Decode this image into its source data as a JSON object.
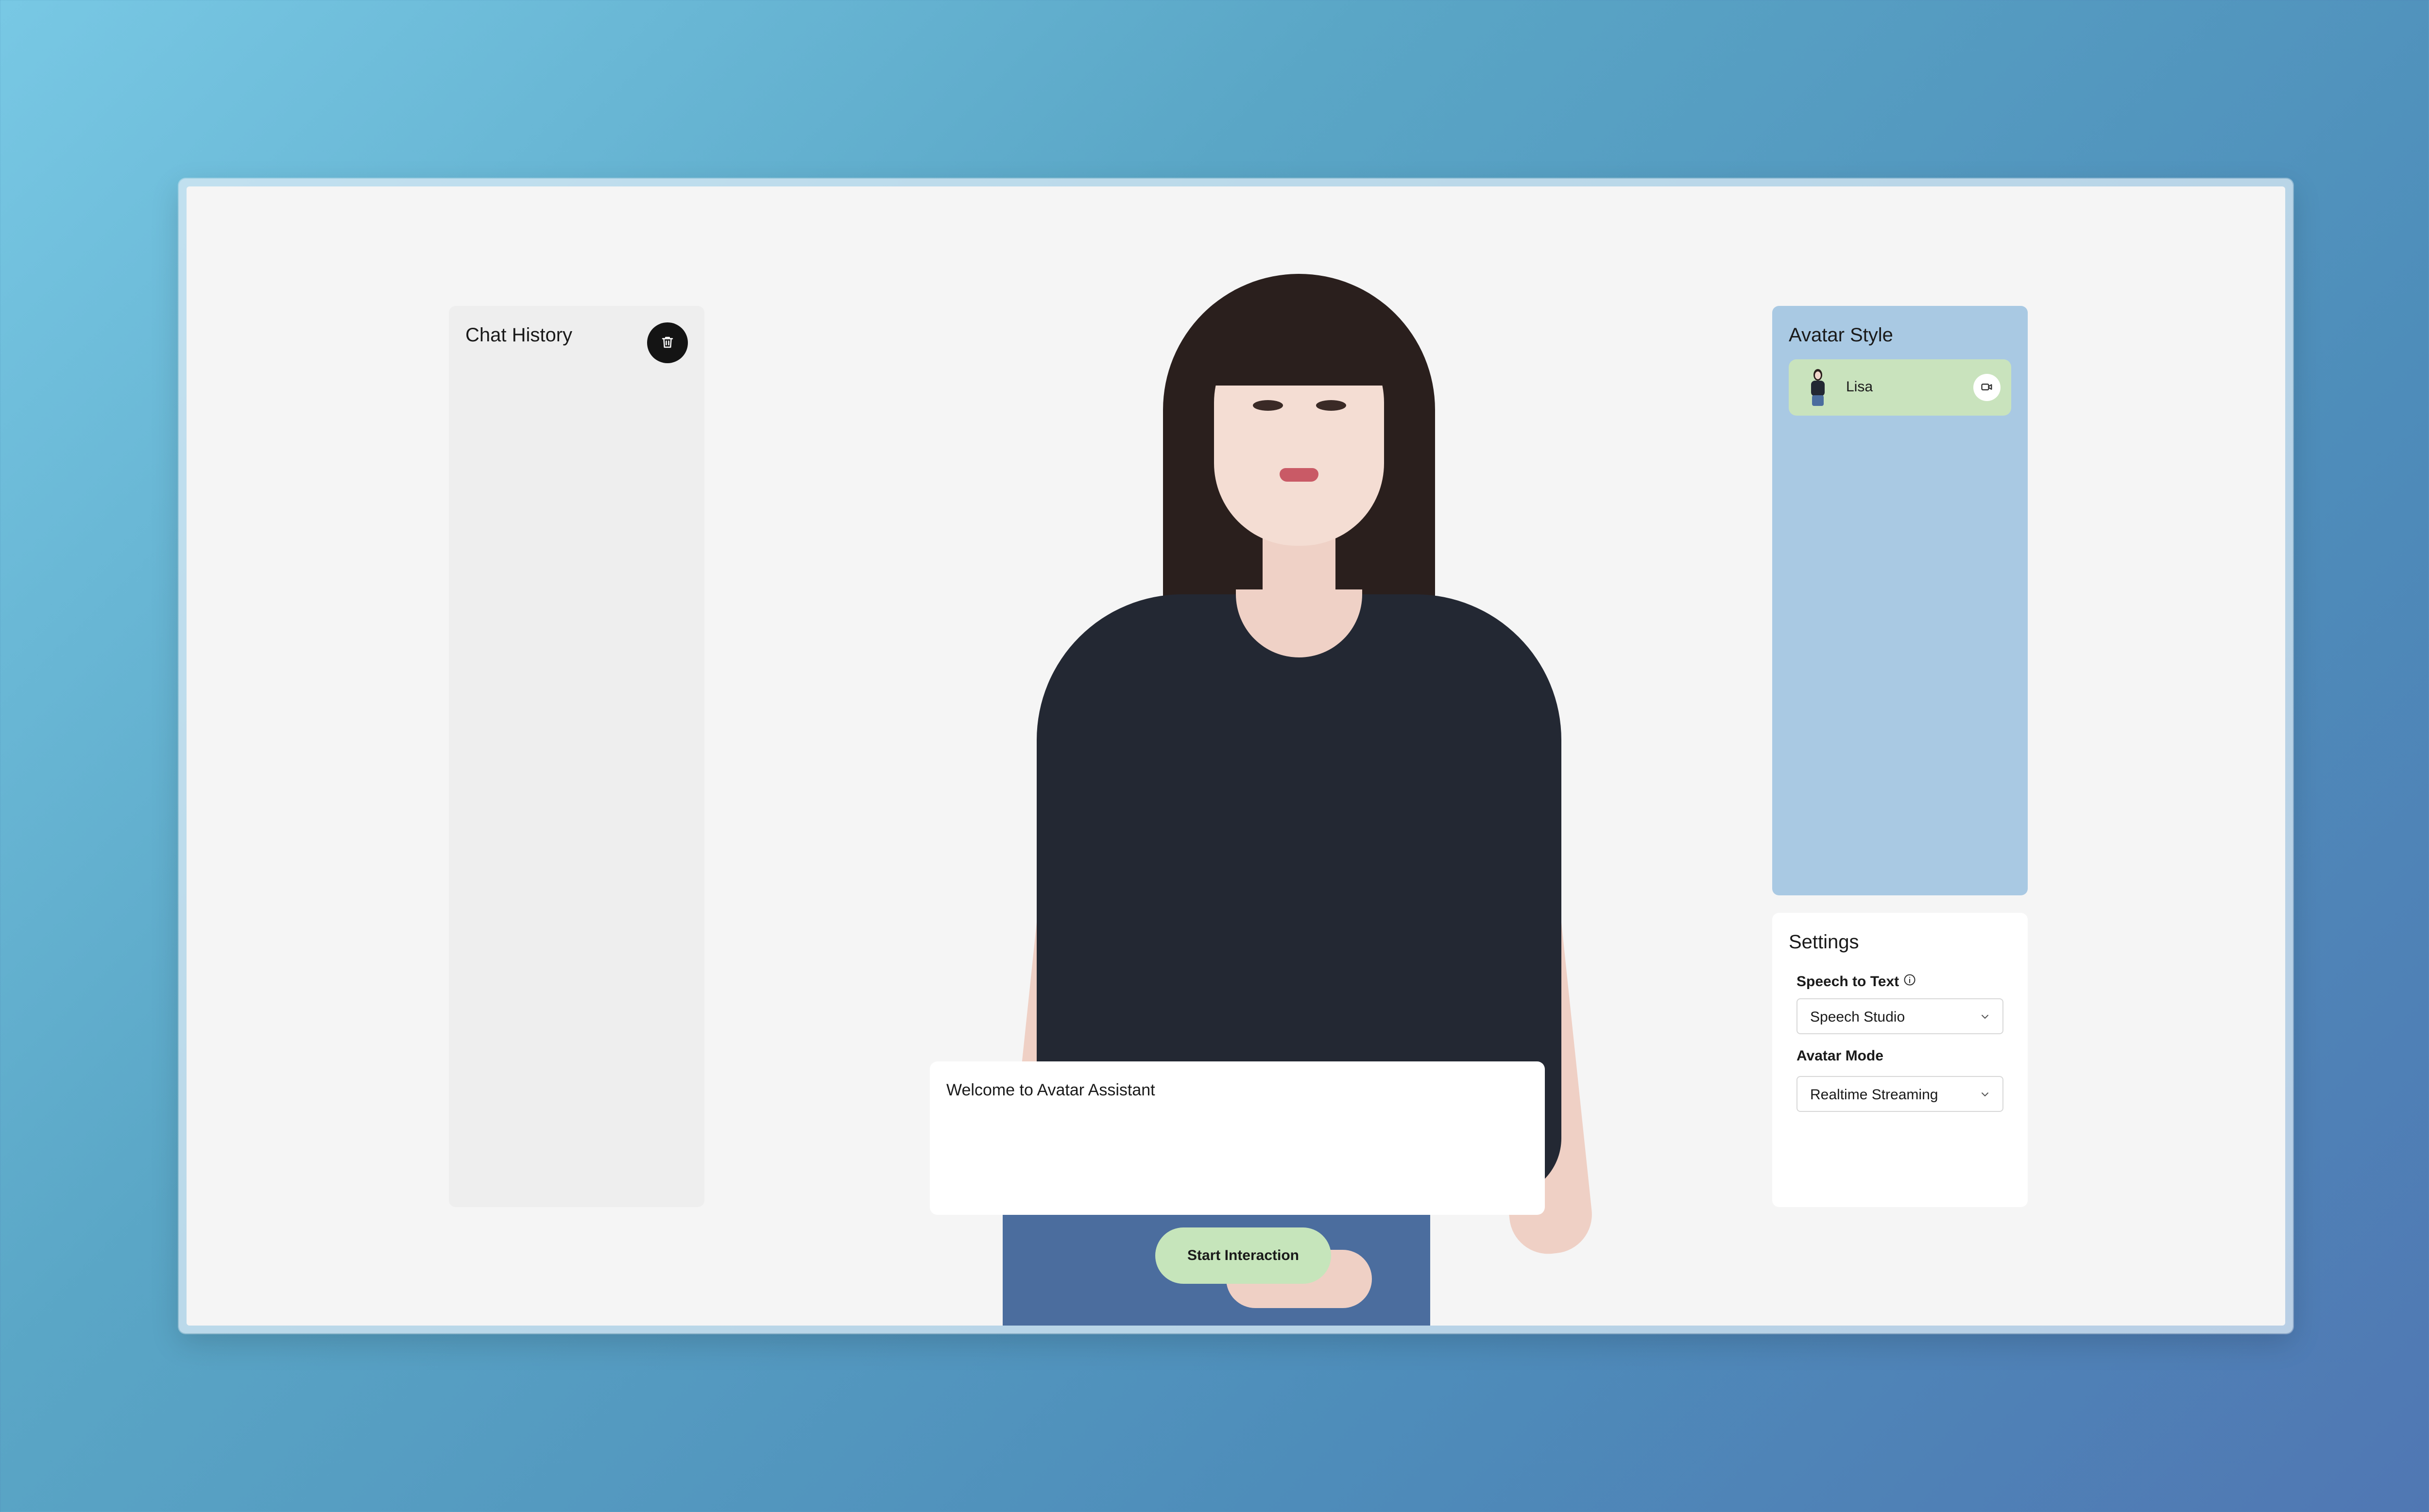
{
  "chat_history": {
    "title": "Chat History",
    "clear_icon": "trash-icon"
  },
  "avatar_style": {
    "title": "Avatar Style",
    "avatars": [
      {
        "name": "Lisa",
        "action_icon": "video-camera-icon",
        "selected": true
      }
    ]
  },
  "settings": {
    "title": "Settings",
    "speech_to_text": {
      "label": "Speech to Text",
      "info_icon": "info-icon",
      "value": "Speech Studio"
    },
    "avatar_mode": {
      "label": "Avatar Mode",
      "value": "Realtime Streaming"
    }
  },
  "conversation": {
    "welcome_message": "Welcome to Avatar Assistant"
  },
  "actions": {
    "start_label": "Start Interaction"
  },
  "colors": {
    "avatar_style_panel": "#a9c9e3",
    "selected_avatar_card": "#c9e3bd",
    "start_button": "#c6e5bb",
    "chat_panel": "#eeeeee",
    "canvas": "#f5f5f5"
  }
}
